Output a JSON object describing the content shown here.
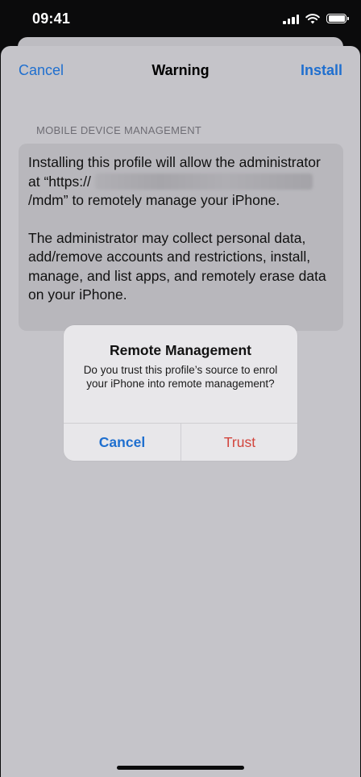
{
  "status_bar": {
    "time": "09:41"
  },
  "nav": {
    "cancel_label": "Cancel",
    "title": "Warning",
    "install_label": "Install"
  },
  "section": {
    "header": "MOBILE DEVICE MANAGEMENT"
  },
  "info": {
    "line1_prefix": "Installing this profile will allow the administrator at “https://",
    "line1_suffix": "/mdm” to remotely manage your iPhone.",
    "paragraph2": "The administrator may collect personal data, add/remove accounts and restrictions, install, manage, and list apps, and remotely erase data on your iPhone."
  },
  "alert": {
    "title": "Remote Management",
    "message": "Do you trust this profile’s source to enrol your iPhone into remote management?",
    "cancel_label": "Cancel",
    "trust_label": "Trust"
  },
  "colors": {
    "accent_blue": "#1f6fcf",
    "destructive_red": "#d2443c"
  },
  "icons": [
    "cellular-signal-icon",
    "wifi-icon",
    "battery-icon"
  ]
}
